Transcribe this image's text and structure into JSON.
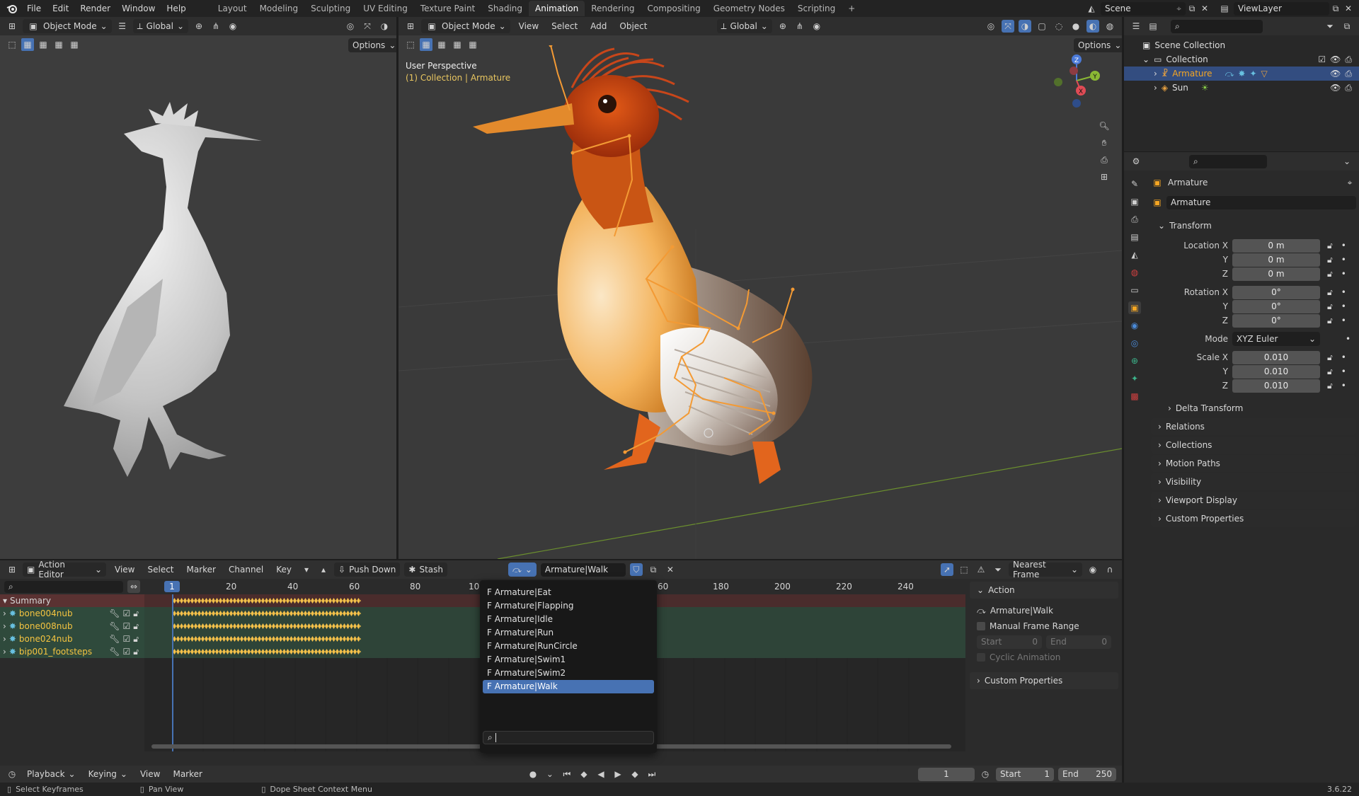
{
  "topbar": {
    "menus": [
      "File",
      "Edit",
      "Render",
      "Window",
      "Help"
    ],
    "workspaces": [
      "Layout",
      "Modeling",
      "Sculpting",
      "UV Editing",
      "Texture Paint",
      "Shading",
      "Animation",
      "Rendering",
      "Compositing",
      "Geometry Nodes",
      "Scripting"
    ],
    "active_workspace": "Animation",
    "add_tab": "+",
    "scene": "Scene",
    "view_layer": "ViewLayer"
  },
  "left_viewport": {
    "mode": "Object Mode",
    "orientation": "Global",
    "options": "Options"
  },
  "main_viewport": {
    "mode": "Object Mode",
    "menus": [
      "View",
      "Select",
      "Add",
      "Object"
    ],
    "orientation": "Global",
    "options": "Options",
    "perspective": "User Perspective",
    "collection_path": "(1) Collection | Armature",
    "gizmo": {
      "z": "Z",
      "y": "Y",
      "x": "X"
    }
  },
  "outliner": {
    "scene_collection": "Scene Collection",
    "collection": "Collection",
    "items": [
      {
        "name": "Armature",
        "selected": true
      },
      {
        "name": "Sun",
        "selected": false
      }
    ]
  },
  "properties": {
    "object_name": "Armature",
    "data_name": "Armature",
    "transform_title": "Transform",
    "location": {
      "label_x": "Location X",
      "x": "0 m",
      "y": "0 m",
      "z": "0 m"
    },
    "rotation": {
      "label_x": "Rotation X",
      "x": "0°",
      "y": "0°",
      "z": "0°"
    },
    "axis_y": "Y",
    "axis_z": "Z",
    "mode_label": "Mode",
    "mode_value": "XYZ Euler",
    "scale": {
      "label_x": "Scale X",
      "x": "0.010",
      "y": "0.010",
      "z": "0.010"
    },
    "delta_transform": "Delta Transform",
    "panels": [
      "Relations",
      "Collections",
      "Motion Paths",
      "Visibility",
      "Viewport Display",
      "Custom Properties"
    ]
  },
  "action_editor": {
    "editor": "Action Editor",
    "menus": [
      "View",
      "Select",
      "Marker",
      "Channel",
      "Key"
    ],
    "push_down": "Push Down",
    "stash": "Stash",
    "action_name": "Armature|Walk",
    "snap": "Nearest Frame",
    "current_frame_badge": "1",
    "ruler_left": [
      "20",
      "40",
      "60",
      "80",
      "10"
    ],
    "ruler_right": [
      "60",
      "180",
      "200",
      "220",
      "240"
    ],
    "channels": [
      {
        "name": "Summary"
      },
      {
        "name": "bone004nub"
      },
      {
        "name": "bone008nub"
      },
      {
        "name": "bone024nub"
      },
      {
        "name": "bip001_footsteps"
      }
    ],
    "dropdown": {
      "items": [
        "F Armature|Eat",
        "F Armature|Flapping",
        "F Armature|Idle",
        "F Armature|Run",
        "F Armature|RunCircle",
        "F Armature|Swim1",
        "F Armature|Swim2",
        "F Armature|Walk"
      ],
      "selected_index": 7
    },
    "side_panel": {
      "action_title": "Action",
      "action_name": "Armature|Walk",
      "manual_frame_range": "Manual Frame Range",
      "start_label": "Start",
      "start_value": "0",
      "end_label": "End",
      "end_value": "0",
      "cyclic": "Cyclic Animation",
      "custom_properties": "Custom Properties"
    }
  },
  "timeline": {
    "playback": "Playback",
    "keying": "Keying",
    "view": "View",
    "marker": "Marker",
    "current_frame": "1",
    "start_label": "Start",
    "start": "1",
    "end_label": "End",
    "end": "250"
  },
  "statusbar": {
    "items": [
      "Select Keyframes",
      "Pan View",
      "Dope Sheet Context Menu"
    ],
    "version": "3.6.22"
  },
  "colors": {
    "accent": "#4772b3",
    "active_object": "#f5a623",
    "bone": "#f39a34",
    "channel_green": "#2f4a3c",
    "summary_red": "#5a3232"
  }
}
